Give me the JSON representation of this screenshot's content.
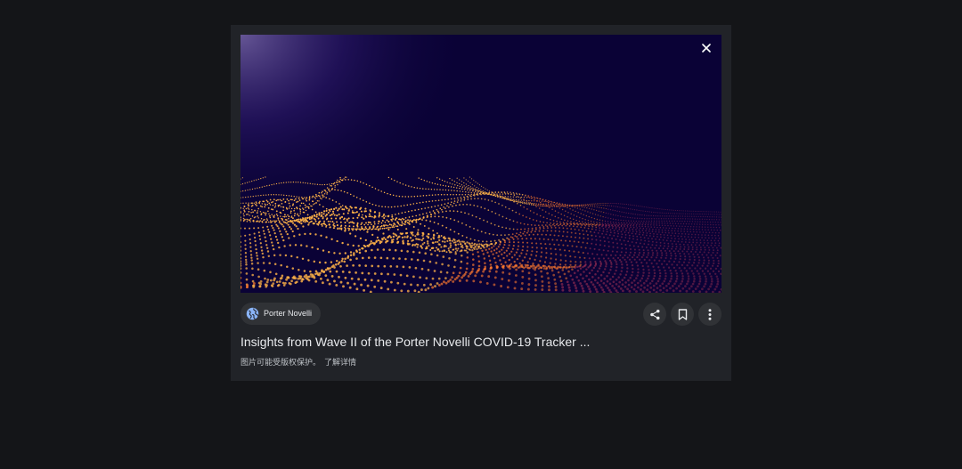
{
  "image": {
    "alt": "Orange particle wave landscape on dark purple background",
    "close_icon": "close-icon"
  },
  "source": {
    "name": "Porter Novelli",
    "icon": "globe-icon",
    "icon_color": "#8ab4f8"
  },
  "actions": [
    {
      "name": "share-button",
      "icon": "share-icon"
    },
    {
      "name": "save-button",
      "icon": "bookmark-icon"
    },
    {
      "name": "more-options-button",
      "icon": "more-vert-icon"
    }
  ],
  "result": {
    "title": "Insights from Wave II of the Porter Novelli COVID-19 Tracker ...",
    "copyright_notice": "图片可能受版权保护。",
    "learn_more": "了解详情"
  },
  "colors": {
    "page_background": "#141518",
    "panel_background": "#212328",
    "chip_background": "#303236",
    "image_background": "#0a0236",
    "wave_bright": "#ffb347",
    "wave_mid": "#ff7a2e",
    "wave_dim": "#c0395a"
  }
}
